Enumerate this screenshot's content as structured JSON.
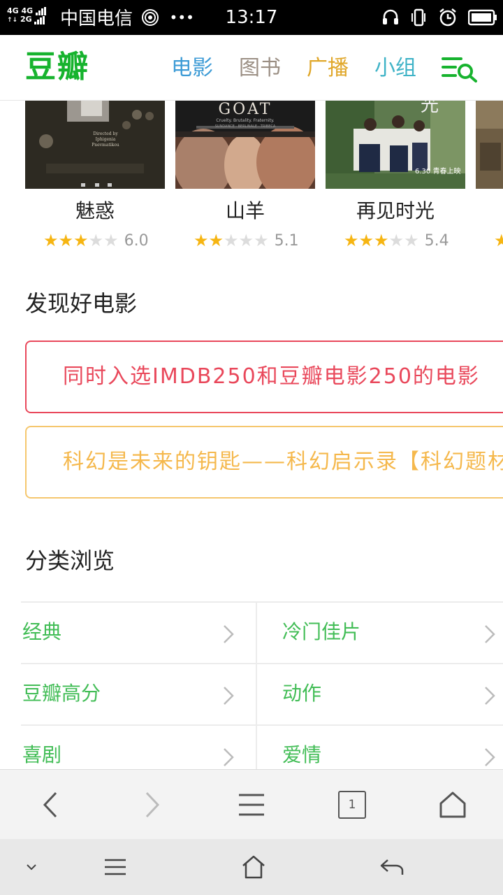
{
  "status_bar": {
    "network_top": "4G 4G",
    "network_bottom": "2G",
    "carrier": "中国电信",
    "more": "•••",
    "time": "13:17"
  },
  "header": {
    "logo": "豆瓣",
    "nav": [
      {
        "label": "电影",
        "color": "#3d9bd6"
      },
      {
        "label": "图书",
        "color": "#9b8f84"
      },
      {
        "label": "广播",
        "color": "#e0a72a"
      },
      {
        "label": "小组",
        "color": "#3fb3c7"
      }
    ],
    "accent_color": "#17b32e"
  },
  "movies": [
    {
      "title": "魅惑",
      "rating": "6.0",
      "stars": 3
    },
    {
      "title": "山羊",
      "rating": "5.1",
      "stars": 2
    },
    {
      "title": "再见时光",
      "rating": "5.4",
      "stars": 3
    },
    {
      "title": "",
      "rating": "",
      "stars": 1
    }
  ],
  "poster_text": {
    "goat_title": "GOAT",
    "goat_sub": "Cruelty. Brutality. Fraternity.",
    "goat_laurels": "SUNDANCE · BERLINALE · TRIBECA",
    "seduction_credit": "Directed by",
    "seduction_director": "Iphigenia Pnevmatikou",
    "goodbye_title_char": "光",
    "goodbye_date": "6.30 青春上映"
  },
  "discover": {
    "title": "发现好电影",
    "items": [
      {
        "label": "同时入选IMDB250和豆瓣电影250的电影",
        "color": "#e9485b"
      },
      {
        "label": "科幻是未来的钥匙——科幻启示录【科幻题材",
        "color": "#f5b84c"
      }
    ]
  },
  "categories": {
    "title": "分类浏览",
    "items": [
      "经典",
      "冷门佳片",
      "豆瓣高分",
      "动作",
      "喜剧",
      "爱情"
    ]
  },
  "browser_toolbar": {
    "tab_count": "1"
  }
}
